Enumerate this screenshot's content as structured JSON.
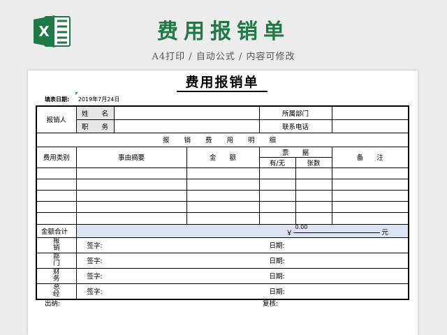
{
  "banner": {
    "logo_letter": "X",
    "title": "费用报销单",
    "subtitle": "A4打印 / 自动公式 / 内容可修改",
    "accent": "#1d7a45"
  },
  "sheet": {
    "title": "费用报销单",
    "fill_date_label": "填表日期:",
    "fill_date_value": "2019年7月24日",
    "claimant_label": "报销人",
    "name_label": "姓　　名",
    "position_label": "职　　务",
    "dept_label": "所属部门",
    "phone_label": "联系电话",
    "detail_title": "报 销 费 用 明 细",
    "headers": {
      "category": "费用类别",
      "summary": "事由摘要",
      "amount": "金　　额",
      "receipt": "票　　据",
      "has_receipt": "有/无",
      "count": "张数",
      "remark": "备　　注"
    },
    "total_label": "金额合计",
    "total_currency": "￥",
    "total_amount": "0.00",
    "total_unit": "元",
    "approvals": [
      {
        "dept": "报销部门",
        "sign": "签字:",
        "date": "日期:"
      },
      {
        "dept": "财务部门",
        "sign": "签字:",
        "date": "日期:"
      },
      {
        "dept": "总经理",
        "sign": "签字:",
        "date": "日期:"
      },
      {
        "dept": "",
        "sign": "签字:",
        "date": "日期:"
      }
    ],
    "approval_depts_shown": [
      "报",
      "销",
      "部",
      "门",
      "财",
      "务",
      "总",
      "经"
    ],
    "cashier_label": "出纳:",
    "reviewer_label": "复核:"
  }
}
